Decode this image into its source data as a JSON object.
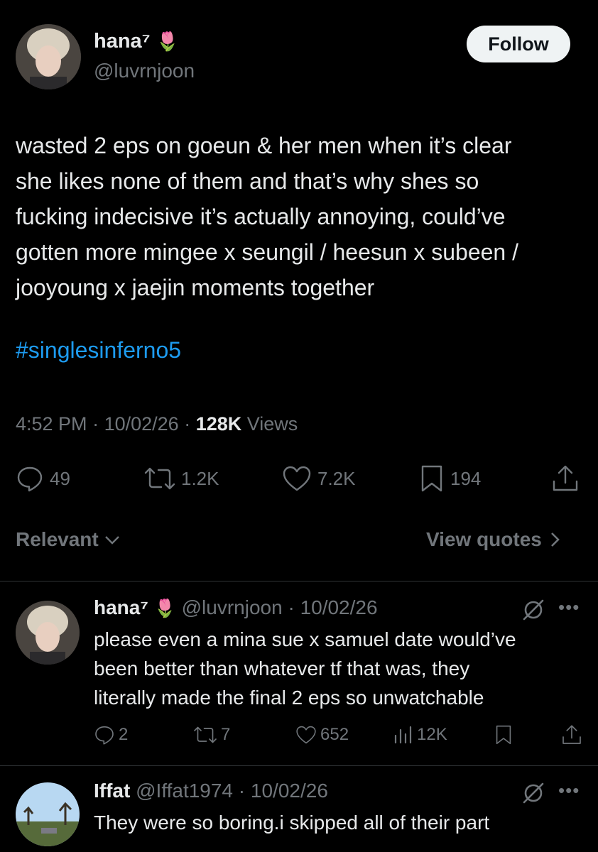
{
  "tweet": {
    "display_name": "hana⁷",
    "name_emoji": "🌷",
    "handle": "@luvrnjoon",
    "follow_label": "Follow",
    "text": "wasted 2 eps on goeun & her men when it’s clear\nshe likes none of them and that’s why shes so\nfucking indecisive it’s actually annoying, could’ve\ngotten more mingee x seungil / heesun x subeen /\njooyoung x jaejin moments together",
    "hashtag": "#singlesinferno5",
    "time": "4:52 PM",
    "date": "10/02/26",
    "views_count": "128K",
    "views_label": "Views",
    "stats": {
      "replies": "49",
      "reposts": "1.2K",
      "likes": "7.2K",
      "bookmarks": "194"
    }
  },
  "sort": {
    "label": "Relevant",
    "view_quotes": "View quotes"
  },
  "replies": [
    {
      "display_name": "hana⁷",
      "name_emoji": "🌷",
      "handle": "@luvrnjoon",
      "date": "10/02/26",
      "text": "please even a mina sue x samuel date would’ve\nbeen better than whatever tf that was, they\nliterally made the final 2 eps so unwatchable",
      "stats": {
        "replies": "2",
        "reposts": "7",
        "likes": "652",
        "views": "12K"
      }
    },
    {
      "display_name": "Iffat",
      "handle": "@Iffat1974",
      "date": "10/02/26",
      "text": "They were so boring.i skipped all of their part"
    }
  ],
  "colors": {
    "background": "#000000",
    "text": "#e7e9ea",
    "secondary": "#71767b",
    "link": "#1d9bf0",
    "divider": "#2f3336"
  },
  "icons": [
    "reply-icon",
    "repost-icon",
    "like-icon",
    "bookmark-icon",
    "share-icon",
    "views-icon",
    "grok-icon",
    "more-icon",
    "chevron-down-icon",
    "chevron-right-icon"
  ]
}
